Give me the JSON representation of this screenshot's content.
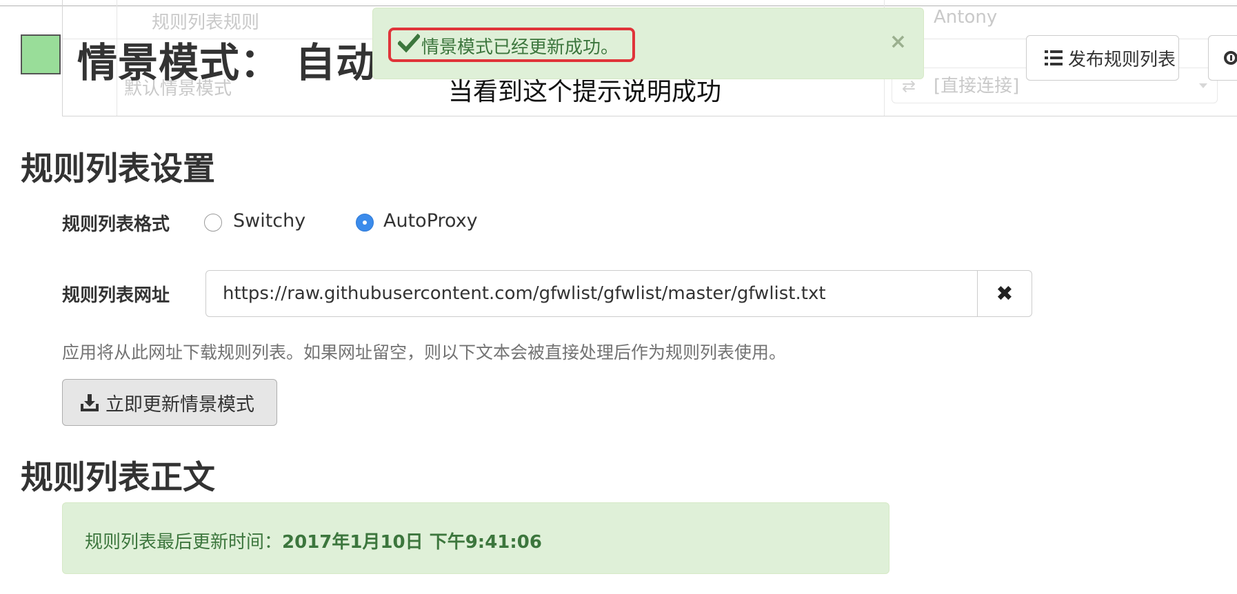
{
  "background_table": {
    "tab_label": "规则列表规则",
    "row_label": "默认情景模式",
    "select_value": "[直接连接]",
    "user_name": "Antony"
  },
  "header": {
    "swatch_color": "#99dd99",
    "title": "情景模式： 自动",
    "publish_button": "发布规则列表"
  },
  "alert": {
    "message": "情景模式已经更新成功。",
    "close": "×",
    "annotation": "当看到这个提示说明成功"
  },
  "settings": {
    "section_title": "规则列表设置",
    "format_label": "规则列表格式",
    "format_options": [
      "Switchy",
      "AutoProxy"
    ],
    "format_selected": "AutoProxy",
    "url_label": "规则列表网址",
    "url_value": "https://raw.githubusercontent.com/gfwlist/gfwlist/master/gfwlist.txt",
    "clear_icon": "✖",
    "help_text": "应用将从此网址下载规则列表。如果网址留空，则以下文本会被直接处理后作为规则列表使用。",
    "update_button": "立即更新情景模式"
  },
  "content": {
    "section_title": "规则列表正文",
    "status_prefix": "规则列表最后更新时间：",
    "status_time": "2017年1月10日 下午9:41:06"
  },
  "colors": {
    "success_bg": "#dff0d8",
    "success_text": "#3c763d",
    "highlight_border": "#e0343a",
    "radio_active": "#3b8beb"
  }
}
